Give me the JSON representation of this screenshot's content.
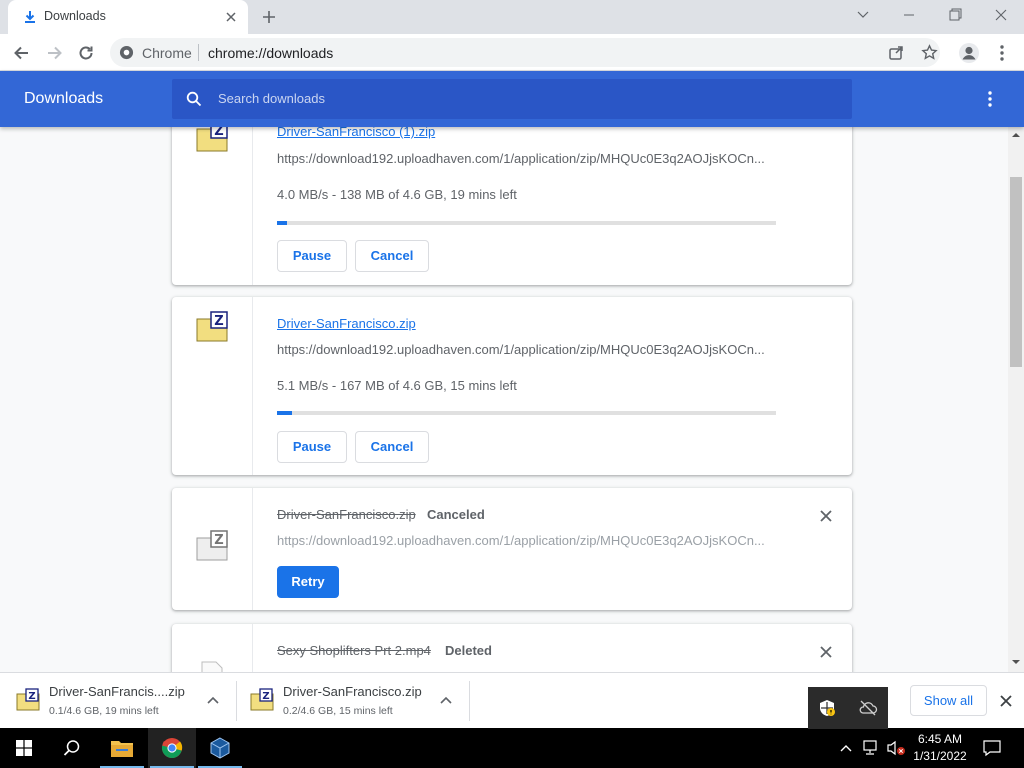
{
  "tab": {
    "title": "Downloads"
  },
  "omnibox": {
    "site": "Chrome",
    "url": "chrome://downloads"
  },
  "header": {
    "title": "Downloads",
    "search_placeholder": "Search downloads"
  },
  "downloads": [
    {
      "name": "Driver-SanFrancisco (1).zip",
      "url": "https://download192.uploadhaven.com/1/application/zip/MHQUc0E3q2AOJjsKOCn...",
      "progress_text": "4.0 MB/s - 138 MB of 4.6 GB, 19 mins left",
      "progress": 0.02,
      "pause_label": "Pause",
      "cancel_label": "Cancel"
    },
    {
      "name": "Driver-SanFrancisco.zip",
      "url": "https://download192.uploadhaven.com/1/application/zip/MHQUc0E3q2AOJjsKOCn...",
      "progress_text": "5.1 MB/s - 167 MB of 4.6 GB, 15 mins left",
      "progress": 0.03,
      "pause_label": "Pause",
      "cancel_label": "Cancel"
    },
    {
      "name": "Driver-SanFrancisco.zip",
      "status": "Canceled",
      "url": "https://download192.uploadhaven.com/1/application/zip/MHQUc0E3q2AOJjsKOCn...",
      "retry_label": "Retry"
    },
    {
      "name": "Sexy Shoplifters Prt 2.mp4",
      "status": "Deleted"
    }
  ],
  "shelf": {
    "items": [
      {
        "name": "Driver-SanFrancis....zip",
        "status": "0.1/4.6 GB, 19 mins left"
      },
      {
        "name": "Driver-SanFrancisco.zip",
        "status": "0.2/4.6 GB, 15 mins left"
      }
    ],
    "show_all_label": "Show all"
  },
  "taskbar": {
    "time": "6:45 AM",
    "date": "1/31/2022"
  },
  "colors": {
    "header": "#3367d6",
    "accent": "#1a73e8",
    "search": "#2a56c6"
  }
}
